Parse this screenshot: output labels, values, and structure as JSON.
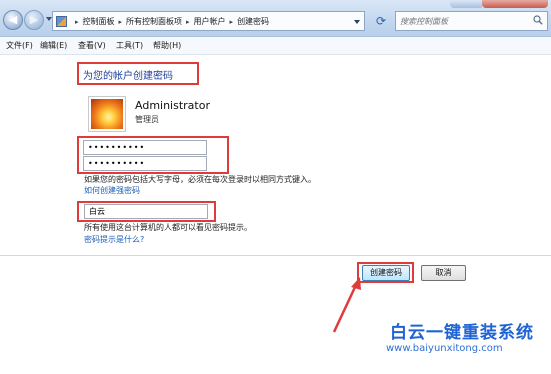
{
  "address_bar": {
    "breadcrumbs": [
      "控制面板",
      "所有控制面板项",
      "用户帐户",
      "创建密码"
    ],
    "search_placeholder": "搜索控制面板"
  },
  "menu": [
    "文件(F)",
    "编辑(E)",
    "查看(V)",
    "工具(T)",
    "帮助(H)"
  ],
  "page": {
    "title": "为您的帐户创建密码",
    "account": {
      "name": "Administrator",
      "role": "管理员"
    },
    "password": "••••••••••",
    "confirm_password": "••••••••••",
    "password_note": "如果您的密码包括大写字母，必须在每次登录时以相同方式键入。",
    "strong_password_link": "如何创建强密码",
    "hint_value": "白云",
    "hint_note": "所有使用这台计算机的人都可以看见密码提示。",
    "hint_link": "密码提示是什么?"
  },
  "buttons": {
    "create": "创建密码",
    "cancel": "取消"
  },
  "watermark": {
    "name": "白云一键重装系统",
    "url": "www.baiyunxitong.com"
  },
  "colors": {
    "highlight": "#e03b3b",
    "link": "#1f5fb5",
    "title": "#1e3f9a",
    "watermark": "#1f63d4"
  }
}
